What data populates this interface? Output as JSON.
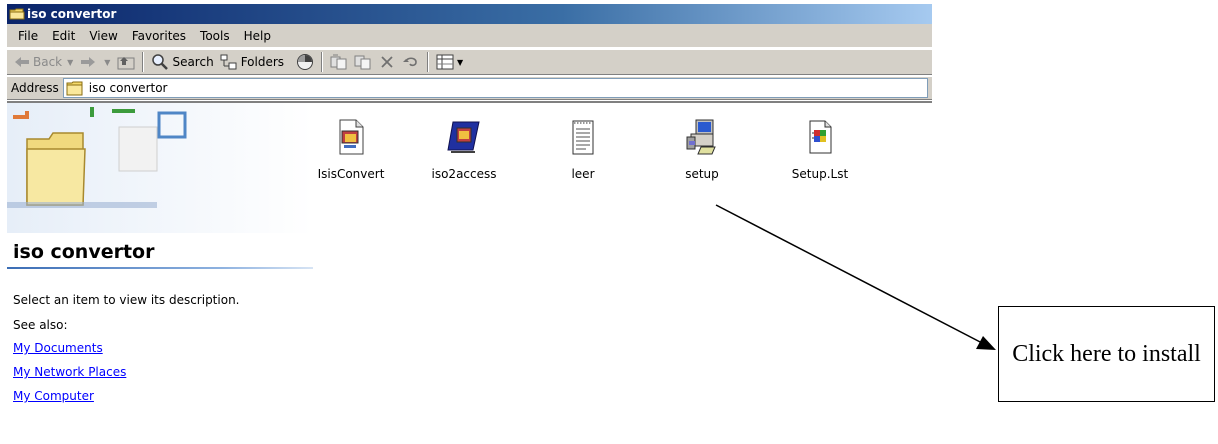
{
  "window": {
    "title": "iso convertor"
  },
  "menubar": {
    "items": [
      "File",
      "Edit",
      "View",
      "Favorites",
      "Tools",
      "Help"
    ]
  },
  "toolbar": {
    "back_label": "Back",
    "search_label": "Search",
    "folders_label": "Folders"
  },
  "addressbar": {
    "label": "Address",
    "value": "iso convertor"
  },
  "leftpane": {
    "title": "iso convertor",
    "description": "Select an item to view its description.",
    "see_also": "See also:",
    "links": [
      "My Documents",
      "My Network Places",
      "My Computer"
    ]
  },
  "files": [
    {
      "name": "IsisConvert",
      "icon": "access-file-icon"
    },
    {
      "name": "iso2access",
      "icon": "access-file-icon"
    },
    {
      "name": "leer",
      "icon": "text-file-icon"
    },
    {
      "name": "setup",
      "icon": "setup-computer-icon"
    },
    {
      "name": "Setup.Lst",
      "icon": "setup-list-file-icon"
    }
  ],
  "annotation": {
    "text": "Click here to install"
  }
}
